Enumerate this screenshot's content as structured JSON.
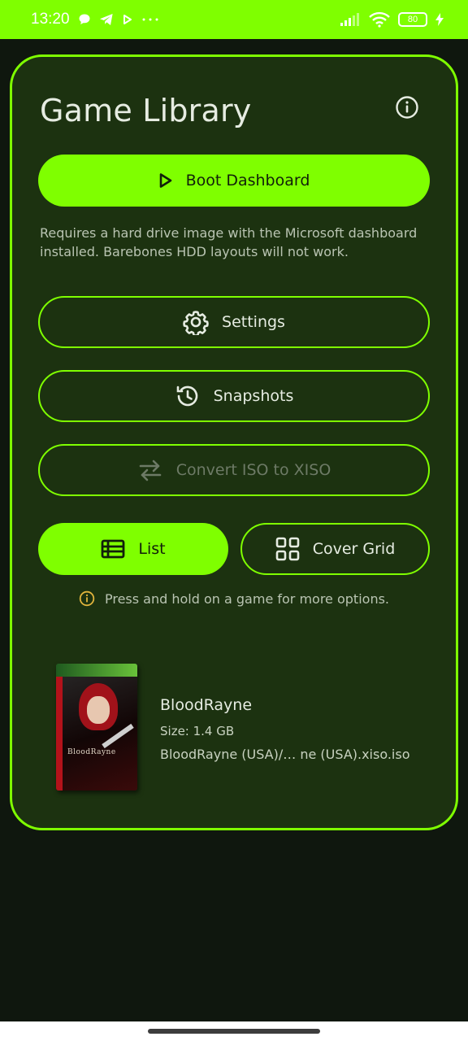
{
  "status_bar": {
    "time": "13:20",
    "battery": "80",
    "icons": [
      "chat-bubble-icon",
      "telegram-icon",
      "play-icon",
      "more-dots-icon",
      "signal-icon",
      "wifi-icon",
      "battery-icon",
      "charging-bolt-icon"
    ]
  },
  "header": {
    "title": "Game Library",
    "info_icon": "info-icon"
  },
  "actions": {
    "boot_label": "Boot Dashboard",
    "boot_icon": "play-outline-icon",
    "boot_description": "Requires a hard drive image with the Microsoft dashboard installed. Barebones HDD layouts will not work.",
    "settings_label": "Settings",
    "settings_icon": "gear-icon",
    "snapshots_label": "Snapshots",
    "snapshots_icon": "history-icon",
    "convert_label": "Convert ISO to XISO",
    "convert_icon": "swap-arrows-icon",
    "convert_disabled": true
  },
  "view_toggle": {
    "list_label": "List",
    "list_icon": "list-icon",
    "list_selected": true,
    "grid_label": "Cover Grid",
    "grid_icon": "grid-icon"
  },
  "hint": {
    "icon": "info-icon",
    "text": "Press and hold on a game for more options."
  },
  "games": [
    {
      "name": "BloodRayne",
      "size": "Size: 1.4 GB",
      "path": "BloodRayne (USA)/… ne (USA).xiso.iso",
      "cover_brand": "XBOX",
      "cover_title": "BloodRayne"
    }
  ],
  "colors": {
    "accent": "#7fff00",
    "card_background": "#1c3210",
    "page_background": "#0f170e",
    "text_primary": "#e6ece2",
    "text_secondary": "#b9c4b2",
    "hint_icon": "#e0b43c"
  }
}
